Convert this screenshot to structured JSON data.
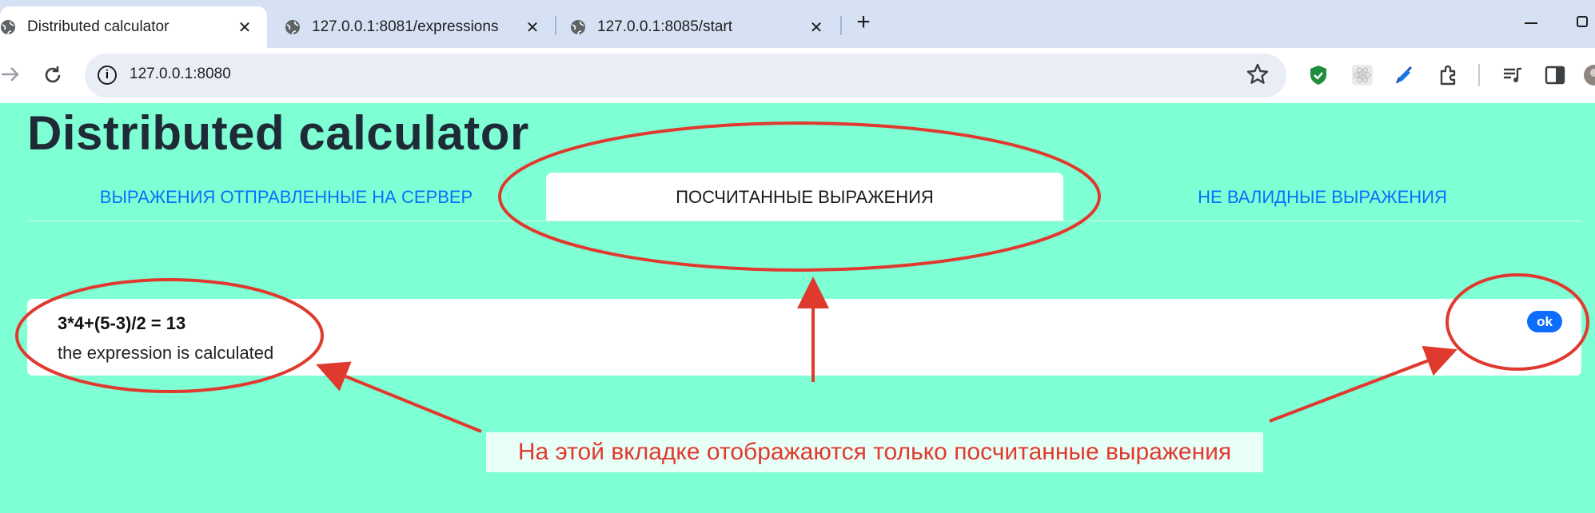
{
  "browser": {
    "tabs": [
      {
        "title": "Distributed calculator",
        "active": true
      },
      {
        "title": "127.0.0.1:8081/expressions",
        "active": false
      },
      {
        "title": "127.0.0.1:8085/start",
        "active": false
      }
    ],
    "close_glyph": "✕",
    "newtab_glyph": "+",
    "address": "127.0.0.1:8080",
    "icons": {
      "forward": "arrow-right-icon",
      "reload": "reload-icon",
      "info": "info-icon",
      "star": "star-icon",
      "minimize": "minimize-icon",
      "maximize": "restore-icon"
    }
  },
  "page": {
    "title": "Distributed calculator",
    "nav_tabs": [
      {
        "label": "ВЫРАЖЕНИЯ ОТПРАВЛЕННЫЕ НА СЕРВЕР",
        "active": false
      },
      {
        "label": "ПОСЧИТАННЫЕ ВЫРАЖЕНИЯ",
        "active": true
      },
      {
        "label": "НЕ ВАЛИДНЫЕ ВЫРАЖЕНИЯ",
        "active": false
      }
    ],
    "expression_card": {
      "expression": "3*4+(5-3)/2 = 13",
      "status_text": "the expression is calculated",
      "badge": "ok"
    }
  },
  "annotation": {
    "caption": "На этой вкладке отображаются только посчитанные выражения"
  },
  "colors": {
    "page_bg": "#7fffd4",
    "link": "#0d6efd",
    "annotation_red": "#e03a2f",
    "badge_bg": "#0d6efd"
  }
}
